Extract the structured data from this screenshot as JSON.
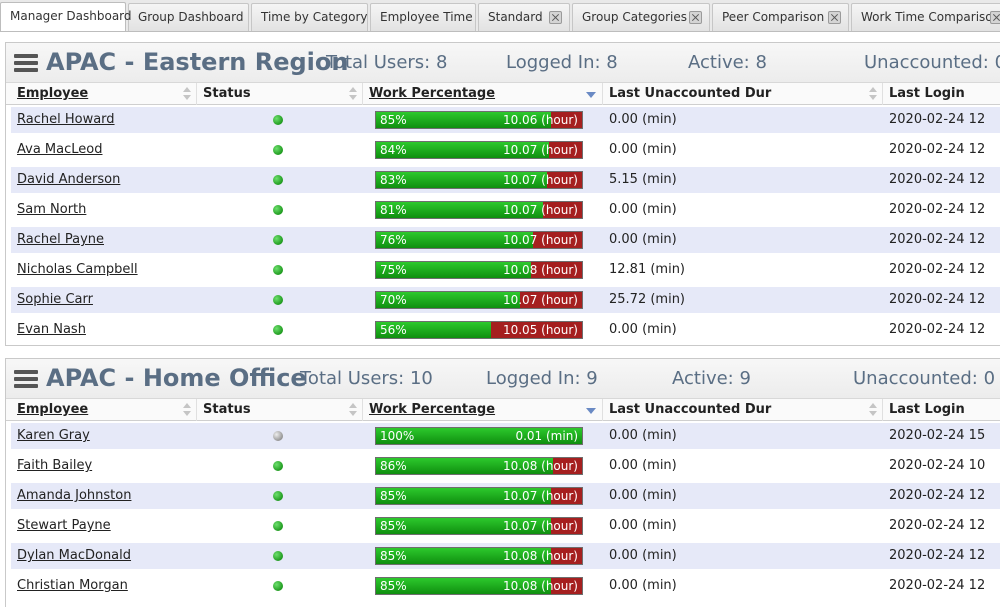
{
  "tabs": [
    {
      "label": "Manager Dashboard",
      "closable": false,
      "active": true
    },
    {
      "label": "Group Dashboard",
      "closable": false,
      "active": false
    },
    {
      "label": "Time by Category",
      "closable": false,
      "active": false
    },
    {
      "label": "Employee Time",
      "closable": false,
      "active": false
    },
    {
      "label": "Standard",
      "closable": true,
      "active": false
    },
    {
      "label": "Group Categories",
      "closable": true,
      "active": false
    },
    {
      "label": "Peer Comparison",
      "closable": true,
      "active": false
    },
    {
      "label": "Work Time Comparison",
      "closable": true,
      "active": false
    }
  ],
  "columns": {
    "employee": "Employee",
    "status": "Status",
    "work": "Work Percentage",
    "unaccounted": "Last Unaccounted Dur",
    "login": "Last Login"
  },
  "colors": {
    "online": "#22aa22",
    "idle": "#9a9a9a",
    "bar_green": "#1fae1f",
    "bar_red": "#a51f1f"
  },
  "groups": [
    {
      "title": "APAC - Eastern Region",
      "total_users": "Total Users: 8",
      "logged_in": "Logged In: 8",
      "active": "Active: 8",
      "unaccounted": "Unaccounted: 0",
      "rows": [
        {
          "employee": "Rachel Howard",
          "status": "online",
          "percent": 85,
          "percent_label": "85%",
          "value": "10.06 (hour)",
          "unaccounted": "0.00 (min)",
          "last_login": "2020-02-24 12"
        },
        {
          "employee": "Ava MacLeod",
          "status": "online",
          "percent": 84,
          "percent_label": "84%",
          "value": "10.07 (hour)",
          "unaccounted": "0.00 (min)",
          "last_login": "2020-02-24 12"
        },
        {
          "employee": "David Anderson",
          "status": "online",
          "percent": 83,
          "percent_label": "83%",
          "value": "10.07 (hour)",
          "unaccounted": "5.15 (min)",
          "last_login": "2020-02-24 12"
        },
        {
          "employee": "Sam North",
          "status": "online",
          "percent": 81,
          "percent_label": "81%",
          "value": "10.07 (hour)",
          "unaccounted": "0.00 (min)",
          "last_login": "2020-02-24 12"
        },
        {
          "employee": "Rachel Payne",
          "status": "online",
          "percent": 76,
          "percent_label": "76%",
          "value": "10.07 (hour)",
          "unaccounted": "0.00 (min)",
          "last_login": "2020-02-24 12"
        },
        {
          "employee": "Nicholas Campbell",
          "status": "online",
          "percent": 75,
          "percent_label": "75%",
          "value": "10.08 (hour)",
          "unaccounted": "12.81 (min)",
          "last_login": "2020-02-24 12"
        },
        {
          "employee": "Sophie Carr",
          "status": "online",
          "percent": 70,
          "percent_label": "70%",
          "value": "10.07 (hour)",
          "unaccounted": "25.72 (min)",
          "last_login": "2020-02-24 12"
        },
        {
          "employee": "Evan Nash",
          "status": "online",
          "percent": 56,
          "percent_label": "56%",
          "value": "10.05 (hour)",
          "unaccounted": "0.00 (min)",
          "last_login": "2020-02-24 12"
        }
      ]
    },
    {
      "title": "APAC - Home Office",
      "total_users": "Total Users: 10",
      "logged_in": "Logged In: 9",
      "active": "Active: 9",
      "unaccounted": "Unaccounted: 0",
      "rows": [
        {
          "employee": "Karen Gray",
          "status": "idle",
          "percent": 100,
          "percent_label": "100%",
          "value": "0.01 (min)",
          "unaccounted": "0.00 (min)",
          "last_login": "2020-02-24 15"
        },
        {
          "employee": "Faith Bailey",
          "status": "online",
          "percent": 86,
          "percent_label": "86%",
          "value": "10.08 (hour)",
          "unaccounted": "0.00 (min)",
          "last_login": "2020-02-24 10"
        },
        {
          "employee": "Amanda Johnston",
          "status": "online",
          "percent": 85,
          "percent_label": "85%",
          "value": "10.07 (hour)",
          "unaccounted": "0.00 (min)",
          "last_login": "2020-02-24 12"
        },
        {
          "employee": "Stewart Payne",
          "status": "online",
          "percent": 85,
          "percent_label": "85%",
          "value": "10.07 (hour)",
          "unaccounted": "0.00 (min)",
          "last_login": "2020-02-24 12"
        },
        {
          "employee": "Dylan MacDonald",
          "status": "online",
          "percent": 85,
          "percent_label": "85%",
          "value": "10.08 (hour)",
          "unaccounted": "0.00 (min)",
          "last_login": "2020-02-24 12"
        },
        {
          "employee": "Christian Morgan",
          "status": "online",
          "percent": 85,
          "percent_label": "85%",
          "value": "10.08 (hour)",
          "unaccounted": "0.00 (min)",
          "last_login": "2020-02-24 12"
        }
      ]
    }
  ]
}
